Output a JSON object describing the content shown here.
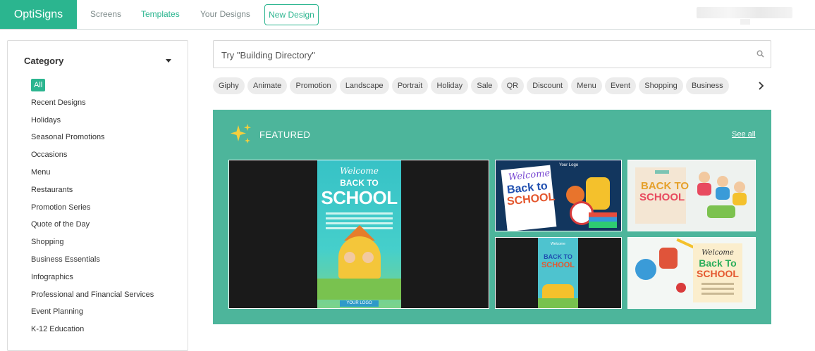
{
  "header": {
    "logo": "OptiSigns",
    "nav": [
      {
        "label": "Screens",
        "active": false
      },
      {
        "label": "Templates",
        "active": true
      },
      {
        "label": "Your Designs",
        "active": false
      }
    ],
    "new_design": "New Design"
  },
  "sidebar": {
    "heading": "Category",
    "items": [
      {
        "label": "All",
        "active": true
      },
      {
        "label": "Recent Designs"
      },
      {
        "label": "Holidays"
      },
      {
        "label": "Seasonal Promotions"
      },
      {
        "label": "Occasions"
      },
      {
        "label": "Menu"
      },
      {
        "label": "Restaurants"
      },
      {
        "label": "Promotion Series"
      },
      {
        "label": "Quote of the Day"
      },
      {
        "label": "Shopping"
      },
      {
        "label": "Business Essentials"
      },
      {
        "label": "Infographics"
      },
      {
        "label": "Professional and Financial Services"
      },
      {
        "label": "Event Planning"
      },
      {
        "label": "K-12 Education"
      }
    ]
  },
  "search": {
    "placeholder": "Try \"Building Directory\"",
    "value": ""
  },
  "chips": [
    "Giphy",
    "Animate",
    "Promotion",
    "Landscape",
    "Portrait",
    "Holiday",
    "Sale",
    "QR",
    "Discount",
    "Menu",
    "Event",
    "Shopping",
    "Business"
  ],
  "featured": {
    "title": "FEATURED",
    "see_all": "See all",
    "tiles": [
      {
        "welcome": "Welcome",
        "line1": "BACK TO",
        "line2": "SCHOOL",
        "logo": "YOUR LOGO"
      },
      {
        "welcome": "Welcome",
        "line1": "Back to",
        "line2": "SCHOOL",
        "logo": "Your Logo"
      },
      {
        "line1": "BACK TO",
        "line2": "SCHOOL"
      },
      {
        "welcome": "Welcome",
        "line1": "BACK TO",
        "line2": "SCHOOL"
      },
      {
        "welcome": "Welcome",
        "line1": "Back To",
        "line2": "SCHOOL"
      }
    ]
  },
  "colors": {
    "brand": "#2bb58f",
    "featured_bg": "#4db59b"
  }
}
